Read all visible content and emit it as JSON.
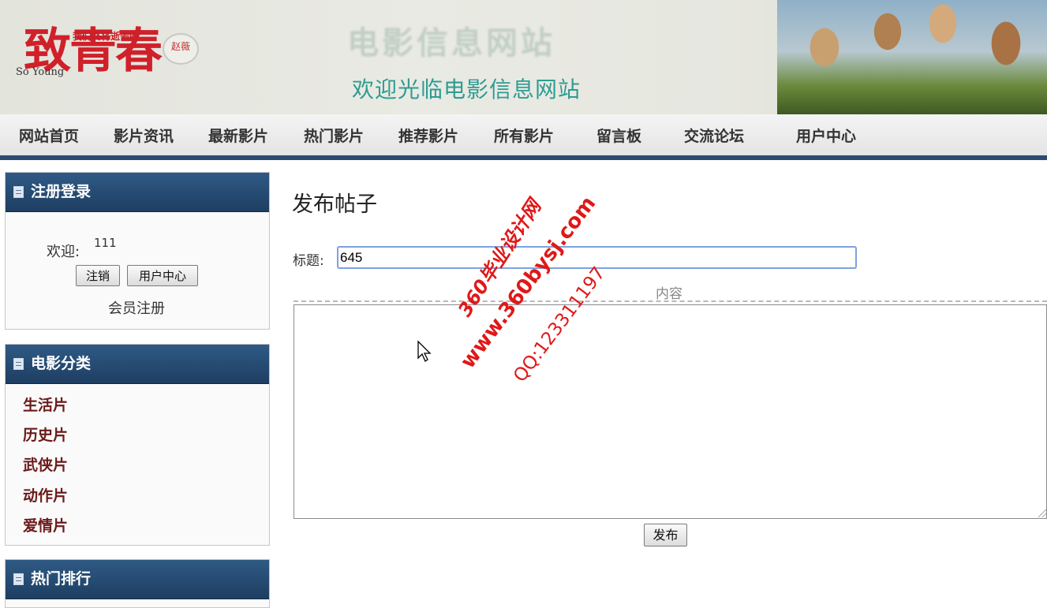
{
  "banner": {
    "logo_main": "致青春",
    "logo_sub": "我们终将逝去的",
    "logo_en": "So Young",
    "logo_seal": "赵薇",
    "title": "电影信息网站",
    "subtitle": "欢迎光临电影信息网站"
  },
  "nav": {
    "items": [
      "网站首页",
      "影片资讯",
      "最新影片",
      "热门影片",
      "推荐影片",
      "所有影片",
      "留言板",
      "交流论坛",
      "用户中心"
    ]
  },
  "sidebar": {
    "login": {
      "heading": "注册登录",
      "welcome_label": "欢迎:",
      "username": "111",
      "logout_button": "注销",
      "user_center_button": "用户中心",
      "register_link": "会员注册"
    },
    "categories": {
      "heading": "电影分类",
      "items": [
        "生活片",
        "历史片",
        "武侠片",
        "动作片",
        "爱情片"
      ]
    },
    "hot": {
      "heading": "热门排行"
    }
  },
  "main": {
    "page_title": "发布帖子",
    "title_label": "标题:",
    "title_value": "645",
    "content_label": "内容",
    "content_value": "",
    "submit_button": "发布"
  },
  "watermark": {
    "line1": "360毕业设计网",
    "line2": "www.360bysj.com",
    "line3": "QQ:123311197",
    "color": "#e01818"
  },
  "colors": {
    "nav_bottom_border": "#2a4a70",
    "panel_header": "#254a72",
    "category_text": "#6b1a1a",
    "input_focus_border": "#7da2e0"
  }
}
